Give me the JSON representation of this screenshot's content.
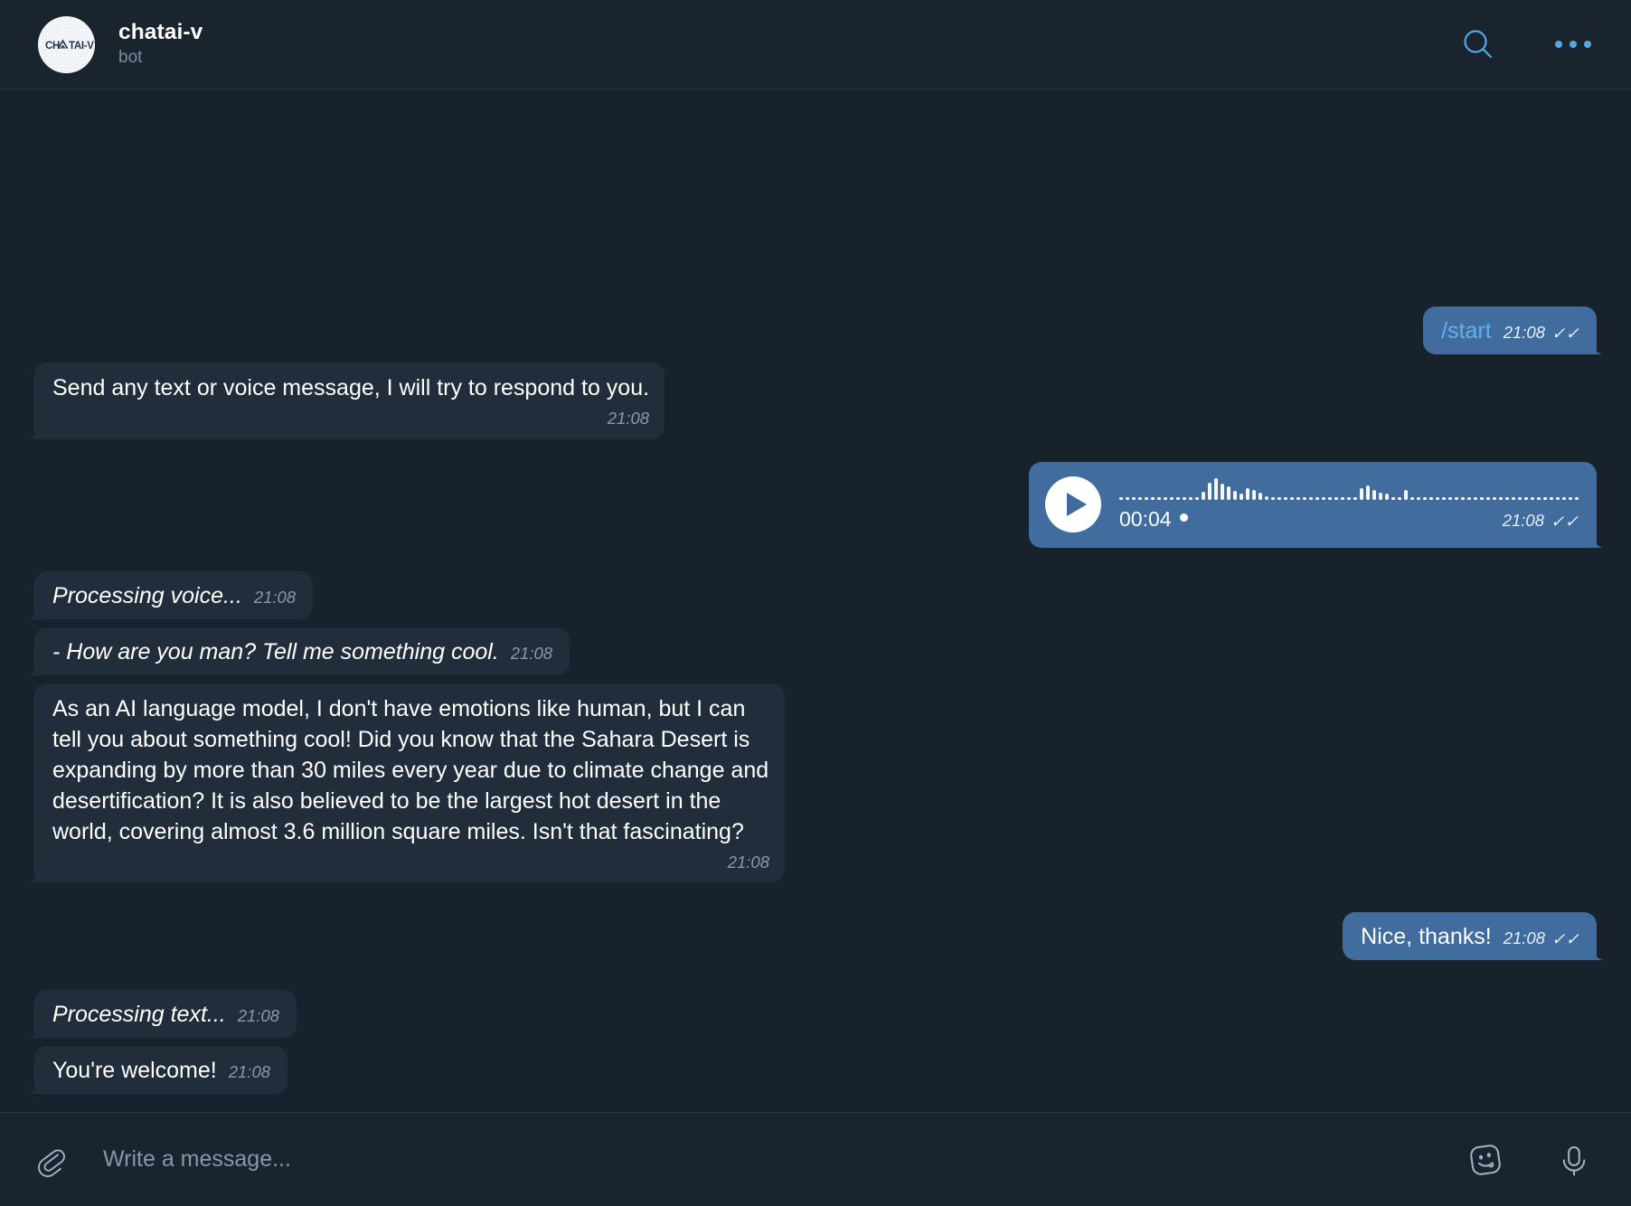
{
  "header": {
    "avatar_text": "CH▲TAI-V",
    "avatar_name": "chatai-v-avatar",
    "title": "chatai-v",
    "status": "bot",
    "search_icon": "search-icon",
    "menu_icon": "more-options-icon",
    "accent_color": "#51a8e8"
  },
  "messages": [
    {
      "id": "m1",
      "side": "out",
      "kind": "text",
      "layout": "compact",
      "command": "/start",
      "text": "",
      "time": "21:08",
      "ticks": "✓✓"
    },
    {
      "id": "m2",
      "side": "in",
      "kind": "text",
      "layout": "block",
      "text": "Send any text or voice message, I will try to respond to you.",
      "time": "21:08",
      "ticks": ""
    },
    {
      "id": "m3",
      "side": "out",
      "kind": "voice",
      "duration": "00:04",
      "time": "21:08",
      "ticks": "✓✓",
      "play_icon": "play-icon",
      "unread_marker": "•"
    },
    {
      "id": "m4",
      "side": "in",
      "kind": "text",
      "layout": "compact",
      "italic": true,
      "text": "Processing voice...",
      "time": "21:08",
      "ticks": ""
    },
    {
      "id": "m5",
      "side": "in",
      "kind": "text",
      "layout": "compact",
      "italic": true,
      "text": "- How are you man? Tell me something cool.",
      "time": "21:08",
      "ticks": ""
    },
    {
      "id": "m6",
      "side": "in",
      "kind": "text",
      "layout": "block",
      "text": "As an AI language model, I don't have emotions like human, but I can tell you about something cool! Did you know that the Sahara Desert is expanding by more than 30 miles every year due to climate change and desertification? It is also believed to be the largest hot desert in the world, covering almost 3.6 million square miles. Isn't that fascinating?",
      "time": "21:08",
      "ticks": ""
    },
    {
      "id": "m7",
      "side": "out",
      "kind": "text",
      "layout": "compact",
      "text": "Nice, thanks!",
      "time": "21:08",
      "ticks": "✓✓"
    },
    {
      "id": "m8",
      "side": "in",
      "kind": "text",
      "layout": "compact",
      "italic": true,
      "text": "Processing text...",
      "time": "21:08",
      "ticks": ""
    },
    {
      "id": "m9",
      "side": "in",
      "kind": "text",
      "layout": "compact",
      "text": "You're welcome!",
      "time": "21:08",
      "ticks": ""
    }
  ],
  "voice_waveform": [
    3,
    3,
    3,
    3,
    3,
    3,
    3,
    3,
    3,
    3,
    3,
    3,
    3,
    9,
    19,
    24,
    18,
    15,
    10,
    7,
    13,
    11,
    8,
    4,
    3,
    3,
    3,
    3,
    3,
    3,
    3,
    3,
    3,
    3,
    3,
    3,
    3,
    3,
    13,
    16,
    11,
    8,
    7,
    3,
    3,
    11,
    3,
    3,
    3,
    3,
    3,
    3,
    3,
    3,
    3,
    3,
    3,
    3,
    3,
    3,
    3,
    3,
    3,
    3,
    3,
    3,
    3,
    3,
    3,
    3,
    3,
    3,
    3
  ],
  "composer": {
    "attach_icon": "paperclip-icon",
    "placeholder": "Write a message...",
    "value": "",
    "emoji_icon": "sticker-emoji-icon",
    "mic_icon": "microphone-icon"
  },
  "theme": {
    "background": "#18222d",
    "panel": "#1a242f",
    "incoming_bubble": "#212d3b",
    "outgoing_bubble": "#406d9e",
    "accent": "#51a8e8",
    "muted_text": "#7c8b9b"
  }
}
